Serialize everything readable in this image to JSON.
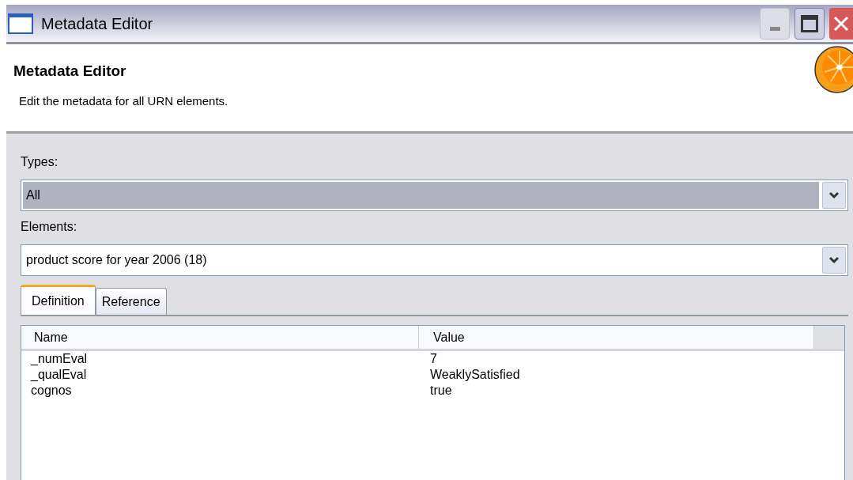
{
  "window": {
    "title": "Metadata Editor"
  },
  "header": {
    "title": "Metadata Editor",
    "description": "Edit the metadata for all URN elements."
  },
  "types": {
    "label": "Types:",
    "value": "All",
    "selected": true
  },
  "elements": {
    "label": "Elements:",
    "value": "product score for year 2006 (18)",
    "selected": false
  },
  "tabs": [
    {
      "label": "Definition",
      "selected": true
    },
    {
      "label": "Reference",
      "selected": false
    }
  ],
  "table": {
    "columns": [
      "Name",
      "Value"
    ],
    "rows": [
      {
        "name": "_numEval",
        "value": "7"
      },
      {
        "name": "_qualEval",
        "value": "WeaklySatisfied"
      },
      {
        "name": "cognos",
        "value": "true"
      }
    ]
  }
}
